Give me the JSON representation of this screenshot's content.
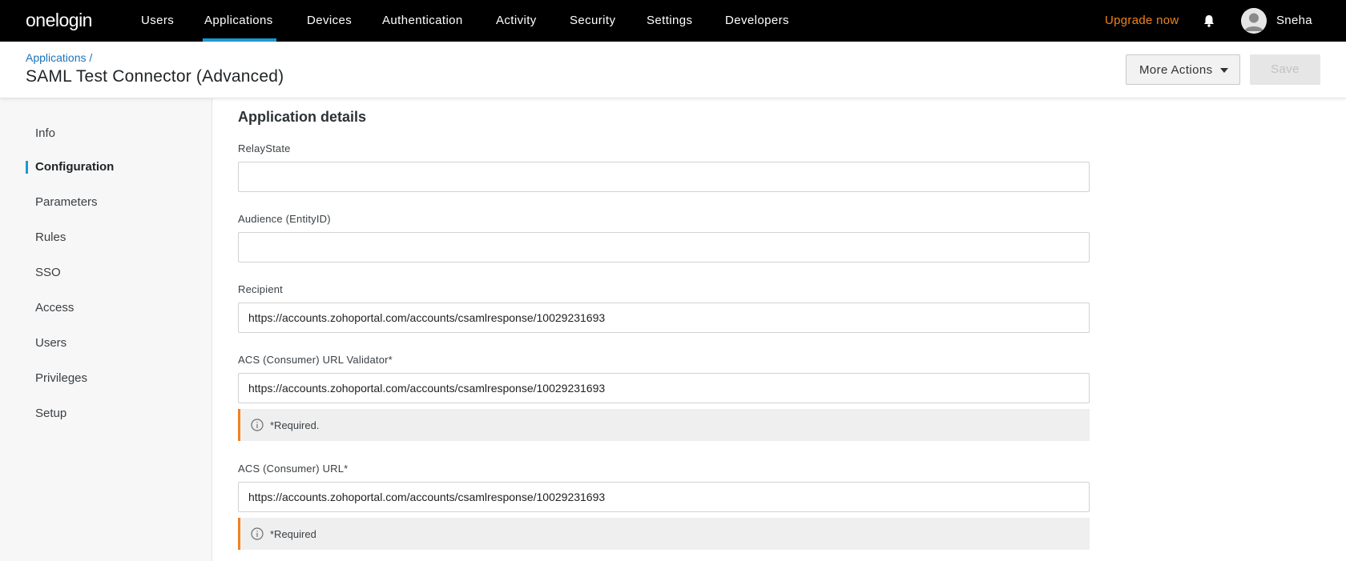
{
  "app": {
    "logo": "onelogin",
    "nav": [
      {
        "label": "Users"
      },
      {
        "label": "Applications",
        "active": true
      },
      {
        "label": "Devices"
      },
      {
        "label": "Authentication"
      },
      {
        "label": "Activity"
      },
      {
        "label": "Security"
      },
      {
        "label": "Settings"
      },
      {
        "label": "Developers"
      }
    ],
    "upgrade_label": "Upgrade now",
    "user_name": "Sneha",
    "colors": {
      "accent": "#1c98d7",
      "upgrade": "#f0821e",
      "topbar": "#000000"
    }
  },
  "header": {
    "breadcrumb": "Applications",
    "breadcrumb_sep": "/",
    "title": "SAML Test Connector (Advanced)",
    "more_actions_label": "More Actions",
    "save_label": "Save"
  },
  "sidebar": {
    "items": [
      {
        "label": "Info"
      },
      {
        "label": "Configuration",
        "active": true
      },
      {
        "label": "Parameters"
      },
      {
        "label": "Rules"
      },
      {
        "label": "SSO"
      },
      {
        "label": "Access"
      },
      {
        "label": "Users"
      },
      {
        "label": "Privileges"
      },
      {
        "label": "Setup"
      }
    ]
  },
  "main": {
    "section_title": "Application details",
    "fields": [
      {
        "label": "RelayState",
        "value": ""
      },
      {
        "label": "Audience (EntityID)",
        "value": ""
      },
      {
        "label": "Recipient",
        "value": "https://accounts.zohoportal.com/accounts/csamlresponse/10029231693"
      },
      {
        "label": "ACS (Consumer) URL Validator*",
        "value": "https://accounts.zohoportal.com/accounts/csamlresponse/10029231693",
        "hint": "*Required."
      },
      {
        "label": "ACS (Consumer) URL*",
        "value": "https://accounts.zohoportal.com/accounts/csamlresponse/10029231693",
        "hint": "*Required"
      }
    ]
  }
}
